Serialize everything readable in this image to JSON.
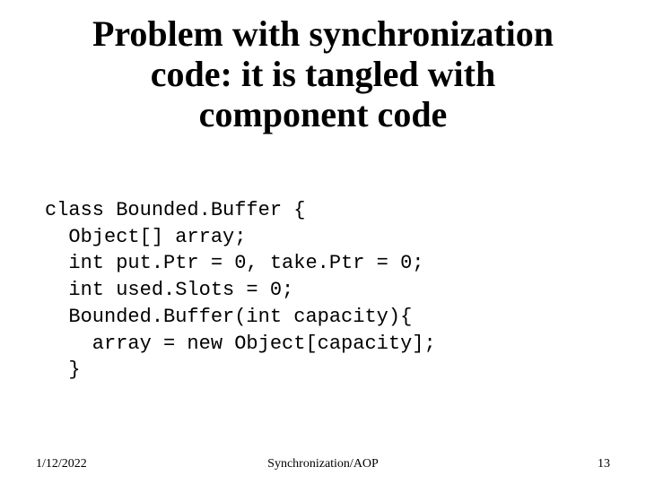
{
  "title": "Problem with synchronization code: it is tangled with component code",
  "code": {
    "l1": "class Bounded.Buffer {",
    "l2": "  Object[] array;",
    "l3": "  int put.Ptr = 0, take.Ptr = 0;",
    "l4": "  int used.Slots = 0;",
    "l5": "  Bounded.Buffer(int capacity){",
    "l6": "    array = new Object[capacity];",
    "l7": "  }"
  },
  "footer": {
    "date": "1/12/2022",
    "center": "Synchronization/AOP",
    "page": "13"
  }
}
